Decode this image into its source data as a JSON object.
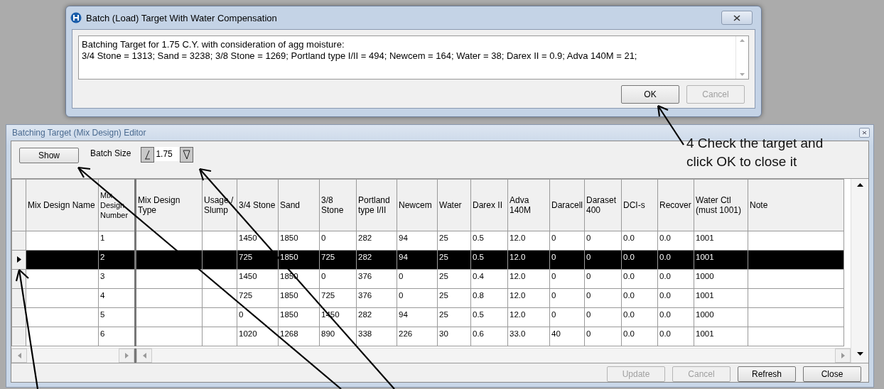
{
  "dialog": {
    "title": "Batch (Load) Target With Water Compensation",
    "message_lines": [
      "Batching Target for 1.75 C.Y. with consideration of agg moisture:",
      "3/4 Stone = 1313; Sand = 3238; 3/8 Stone = 1269; Portland type I/II = 494; Newcem = 164; Water = 38; Darex II = 0.9; Adva 140M = 21;"
    ],
    "buttons": [
      {
        "label": "OK",
        "disabled": false
      },
      {
        "label": "Cancel",
        "disabled": true
      }
    ]
  },
  "editor": {
    "title": "Batching Target (Mix Design) Editor",
    "show_button": "Show",
    "batch_size_label": "Batch Size",
    "batch_size": "1.75",
    "columns": [
      "Mix Design Name",
      "Mix Design Number",
      "Mix Design Type",
      "Usage / Slump",
      "3/4 Stone",
      "Sand",
      "3/8 Stone",
      "Portland type I/II",
      "Newcem",
      "Water",
      "Darex II",
      "Adva 140M",
      "Daracell",
      "Daraset 400",
      "DCI-s",
      "Recover",
      "Water Ctl (must 1001)",
      "Note"
    ],
    "rows": [
      {
        "number": "1",
        "values": [
          "1450",
          "1850",
          "0",
          "282",
          "94",
          "25",
          "0.5",
          "12.0",
          "0",
          "0",
          "0.0",
          "0.0",
          "1001"
        ],
        "selected": false
      },
      {
        "number": "2",
        "values": [
          "725",
          "1850",
          "725",
          "282",
          "94",
          "25",
          "0.5",
          "12.0",
          "0",
          "0",
          "0.0",
          "0.0",
          "1001"
        ],
        "selected": true
      },
      {
        "number": "3",
        "values": [
          "1450",
          "1850",
          "0",
          "376",
          "0",
          "25",
          "0.4",
          "12.0",
          "0",
          "0",
          "0.0",
          "0.0",
          "1000"
        ],
        "selected": false
      },
      {
        "number": "4",
        "values": [
          "725",
          "1850",
          "725",
          "376",
          "0",
          "25",
          "0.8",
          "12.0",
          "0",
          "0",
          "0.0",
          "0.0",
          "1001"
        ],
        "selected": false
      },
      {
        "number": "5",
        "values": [
          "0",
          "1850",
          "1450",
          "282",
          "94",
          "25",
          "0.5",
          "12.0",
          "0",
          "0",
          "0.0",
          "0.0",
          "1000"
        ],
        "selected": false
      },
      {
        "number": "6",
        "values": [
          "1020",
          "1268",
          "890",
          "338",
          "226",
          "30",
          "0.6",
          "33.0",
          "40",
          "0",
          "0.0",
          "0.0",
          "1001"
        ],
        "selected": false
      }
    ],
    "buttons": [
      {
        "label": "Update",
        "disabled": true
      },
      {
        "label": "Cancel",
        "disabled": true
      },
      {
        "label": "Refresh",
        "disabled": false
      },
      {
        "label": "Close",
        "disabled": false
      }
    ]
  },
  "annotation": [
    "4 Check the target and",
    "click OK to close it"
  ]
}
